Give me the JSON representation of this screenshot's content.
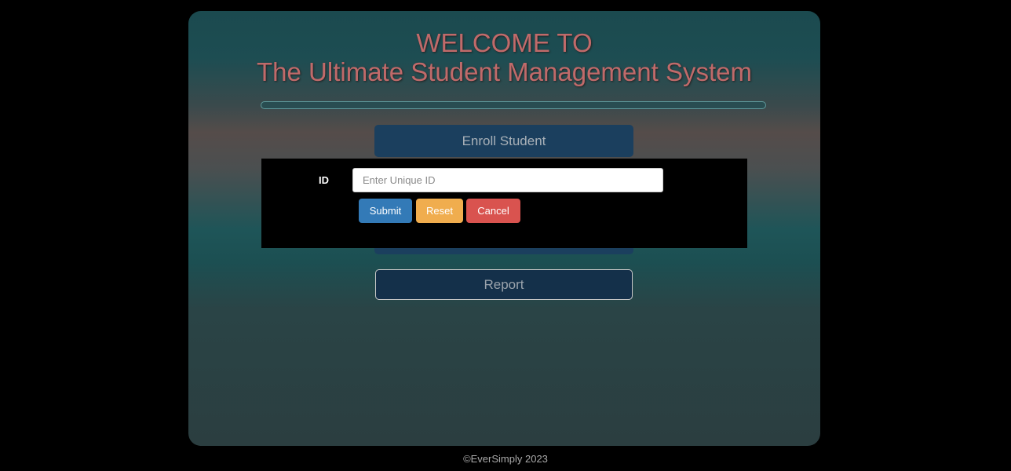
{
  "header": {
    "line1": "WELCOME TO",
    "line2": "The Ultimate Student Management System"
  },
  "nav": {
    "enroll_label": "Enroll Student",
    "report_label": "Report"
  },
  "modal": {
    "id_label": "ID",
    "id_placeholder": "Enter Unique ID",
    "id_value": "",
    "submit_label": "Submit",
    "reset_label": "Reset",
    "cancel_label": "Cancel"
  },
  "footer": {
    "text": "©EverSimply 2023"
  },
  "colors": {
    "page_background": "#000000",
    "title_text": "#c06a6a",
    "nav_button": "#1b3f5e",
    "submit": "#337ab7",
    "reset": "#f0ad4e",
    "cancel": "#d9534f"
  }
}
